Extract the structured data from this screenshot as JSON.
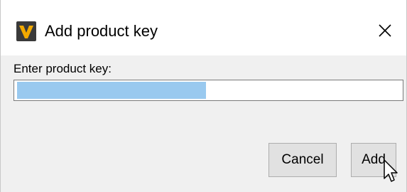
{
  "window": {
    "title": "Add product key",
    "app_icon": "app-logo-icon",
    "close_icon": "close-icon"
  },
  "form": {
    "label": "Enter product key:",
    "input_value": "",
    "selection_color": "#99c9ef"
  },
  "buttons": {
    "cancel_label": "Cancel",
    "add_label": "Add"
  },
  "colors": {
    "button_bg": "#e1e1e1",
    "dialog_bg": "#f0f0f0",
    "logo_accent": "#f2a900"
  }
}
